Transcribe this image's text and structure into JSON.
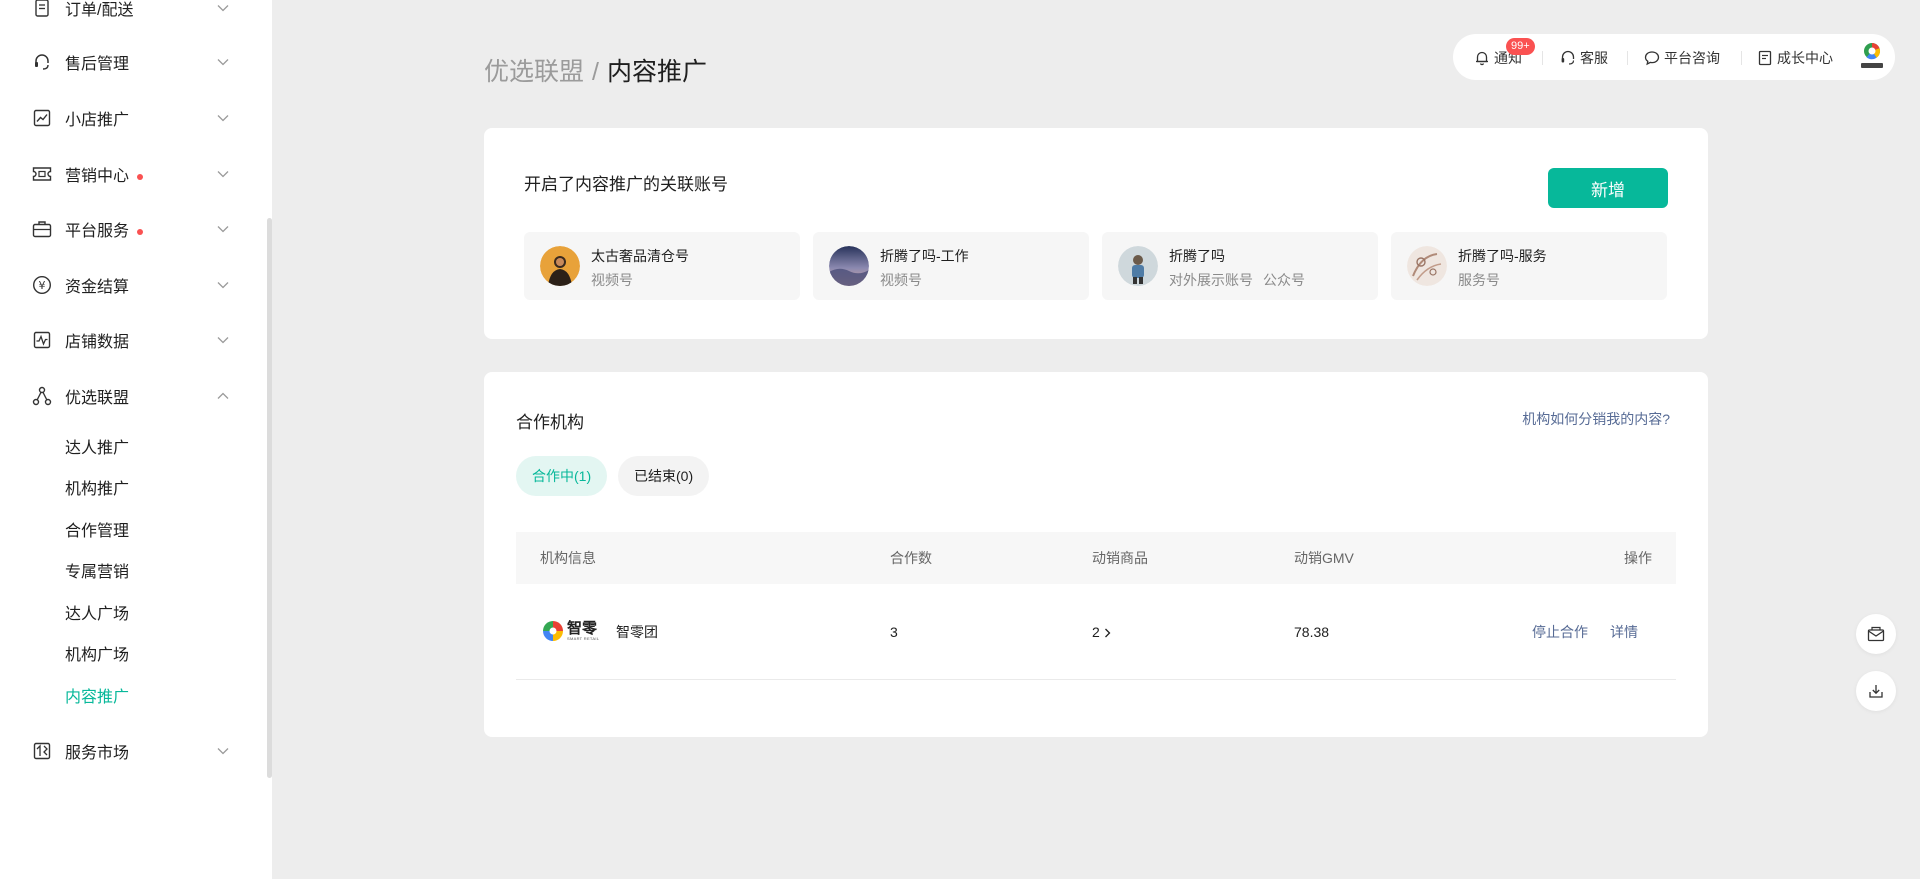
{
  "sidebar": {
    "items": [
      {
        "label": "订单/配送",
        "icon": "document-icon",
        "dot": false
      },
      {
        "label": "售后管理",
        "icon": "headset-icon",
        "dot": false
      },
      {
        "label": "小店推广",
        "icon": "trend-chart-icon",
        "dot": false
      },
      {
        "label": "营销中心",
        "icon": "ticket-icon",
        "dot": true
      },
      {
        "label": "平台服务",
        "icon": "briefcase-icon",
        "dot": true
      },
      {
        "label": "资金结算",
        "icon": "yuan-icon",
        "dot": false
      },
      {
        "label": "店铺数据",
        "icon": "pulse-chart-icon",
        "dot": false
      },
      {
        "label": "优选联盟",
        "icon": "network-icon",
        "dot": false,
        "expanded": true
      },
      {
        "label": "服务市场",
        "icon": "market-icon",
        "dot": false
      }
    ],
    "sub_items": [
      "达人推广",
      "机构推广",
      "合作管理",
      "专属营销",
      "达人广场",
      "机构广场",
      "内容推广"
    ],
    "active_sub": "内容推广",
    "dot_color": "#fa5151"
  },
  "breadcrumb": {
    "parent": "优选联盟",
    "separator": "/",
    "current": "内容推广"
  },
  "topbar": {
    "notice": "通知",
    "notice_badge": "99+",
    "service": "客服",
    "consult": "平台咨询",
    "growth": "成长中心"
  },
  "linked_accounts": {
    "title": "开启了内容推广的关联账号",
    "add_button": "新增",
    "accounts": [
      {
        "name": "太古奢品清仓号",
        "types": [
          "视频号"
        ]
      },
      {
        "name": "折腾了吗-工作",
        "types": [
          "视频号"
        ]
      },
      {
        "name": "折腾了吗",
        "types": [
          "对外展示账号",
          "公众号"
        ]
      },
      {
        "name": "折腾了吗-服务",
        "types": [
          "服务号"
        ]
      }
    ]
  },
  "partners": {
    "title": "合作机构",
    "help_link": "机构如何分销我的内容?",
    "tabs": {
      "active": "合作中(1)",
      "ended": "已结束(0)"
    },
    "columns": {
      "info": "机构信息",
      "count": "合作数",
      "goods": "动销商品",
      "gmv": "动销GMV",
      "ops": "操作"
    },
    "rows": [
      {
        "logo_text": "智零",
        "logo_sub": "SMART RETAIL",
        "name": "智零团",
        "count": "3",
        "goods": "2",
        "gmv": "78.38",
        "stop": "停止合作",
        "detail": "详情"
      }
    ]
  },
  "colors": {
    "accent": "#07b89a",
    "link": "#576b95",
    "badge": "#fa5151"
  }
}
